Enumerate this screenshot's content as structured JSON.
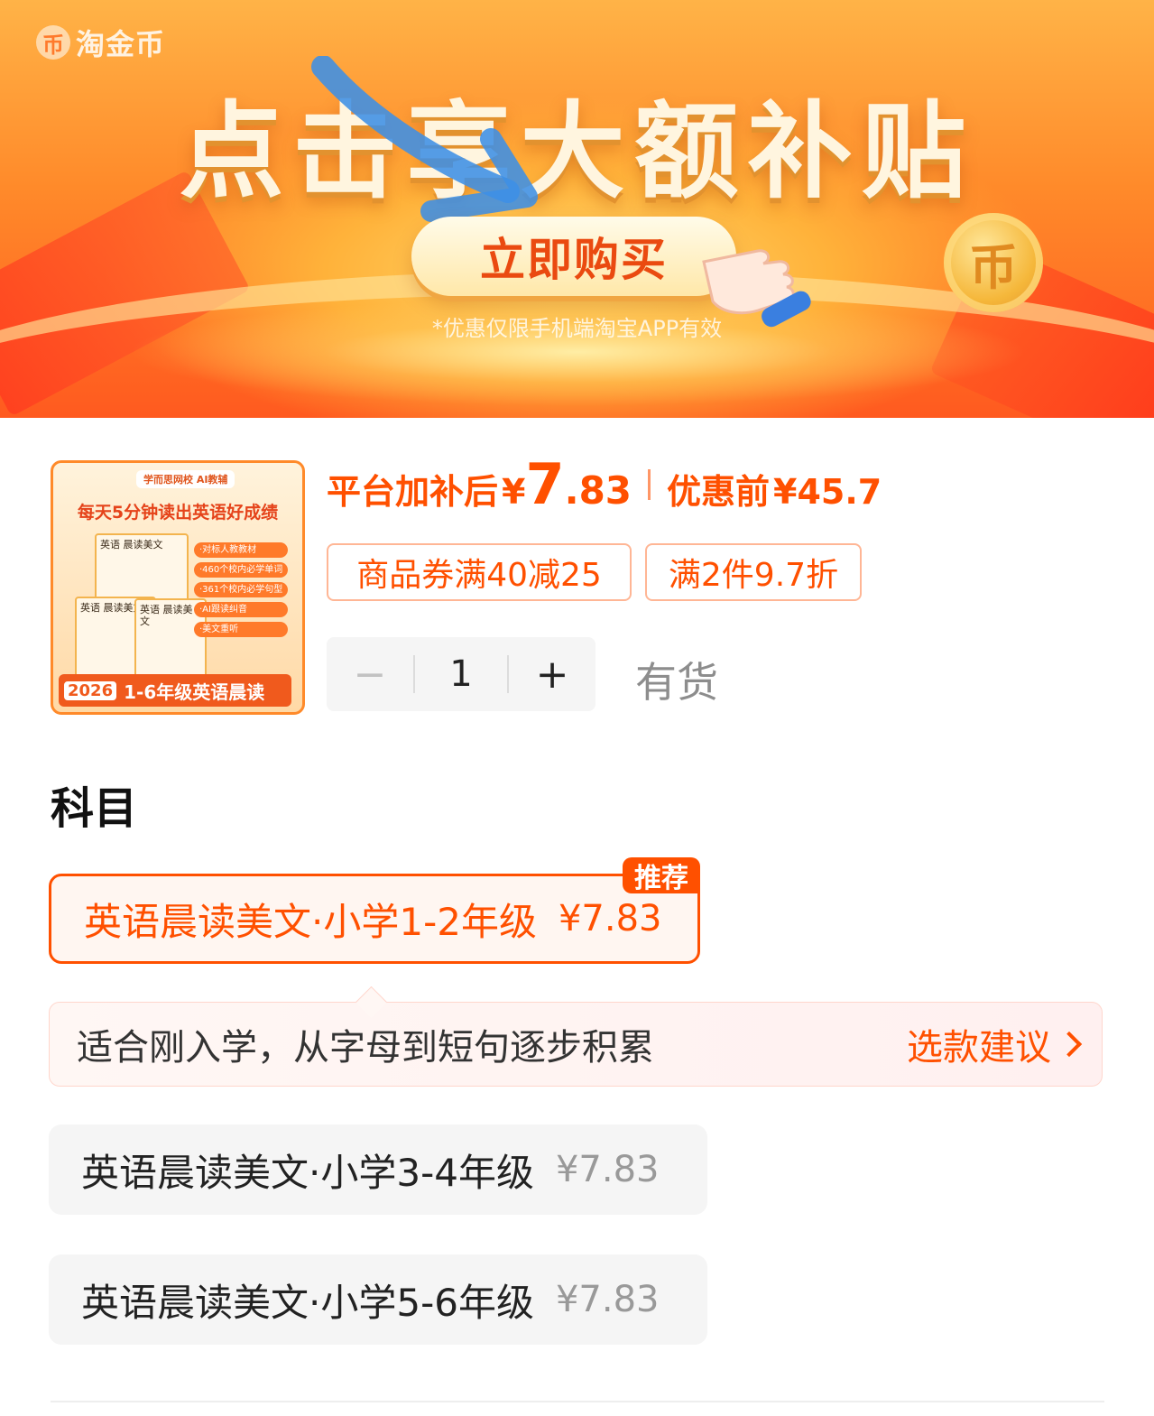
{
  "banner": {
    "logo_icon": "币",
    "logo_text": "淘金币",
    "title": "点击享大额补贴",
    "buy_button": "立即购买",
    "coin_icon": "币",
    "note": "*优惠仅限手机端淘宝APP有效"
  },
  "product": {
    "thumbnail": {
      "brand": "学而思网校 AI教辅",
      "tagline": "每天5分钟读出英语好成绩",
      "book_label": "英语 晨读美文",
      "features": [
        "·对标人教教材",
        "·460个校内必学单词",
        "·361个校内必学句型",
        "·AI跟读纠音",
        "·美文重听"
      ],
      "year": "2026",
      "footer": "1-6年级英语晨读"
    },
    "price_label": "平台加补后",
    "currency": "¥",
    "price_int": "7",
    "price_dec": ".83",
    "orig_label": "优惠前",
    "orig_price": "45.7",
    "coupons": [
      "商品券满40减25",
      "满2件9.7折"
    ],
    "quantity": {
      "minus": "−",
      "value": "1",
      "plus": "+"
    },
    "stock": "有货"
  },
  "options": {
    "title": "科目",
    "badge": "推荐",
    "items": [
      {
        "name": "英语晨读美文·小学1-2年级",
        "price": "¥7.83",
        "selected": true
      },
      {
        "name": "英语晨读美文·小学3-4年级",
        "price": "¥7.83",
        "selected": false
      },
      {
        "name": "英语晨读美文·小学5-6年级",
        "price": "¥7.83",
        "selected": false
      }
    ],
    "tip": {
      "text": "适合刚入学，从字母到短句逐步积累",
      "link": "选款建议"
    }
  },
  "colors": {
    "accent": "#ff5000",
    "banner_orange": "#ff8a2a",
    "muted": "#999999"
  },
  "icons": [
    "coin-icon",
    "arrow-icon",
    "hand-pointer-icon",
    "chevron-right-icon"
  ]
}
